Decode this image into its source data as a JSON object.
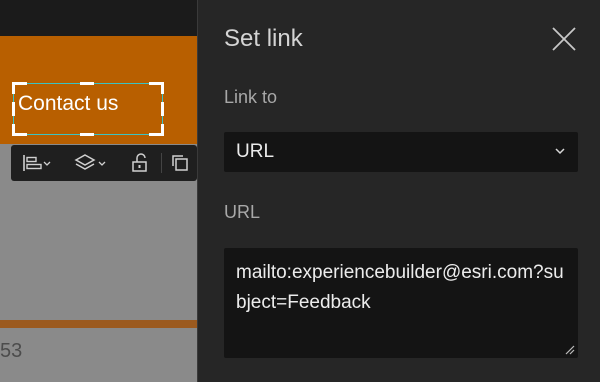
{
  "canvas": {
    "widget_text": "Contact us",
    "bottom_number": "53",
    "toolbar": {
      "items": [
        {
          "name": "align-icon"
        },
        {
          "name": "layers-icon"
        },
        {
          "name": "unlock-icon"
        },
        {
          "name": "duplicate-icon"
        }
      ]
    }
  },
  "panel": {
    "title": "Set link",
    "link_to_label": "Link to",
    "link_to_value": "URL",
    "url_label": "URL",
    "url_value": "mailto:experiencebuilder@esri.com?subject=Feedback"
  },
  "colors": {
    "banner": "#b85f00",
    "panel_bg": "#262626",
    "input_bg": "#141414",
    "selection": "#3cc3c3"
  }
}
